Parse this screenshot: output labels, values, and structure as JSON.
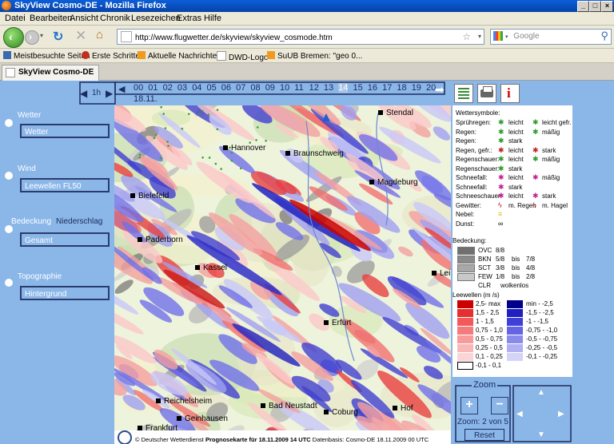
{
  "window": {
    "title": "SkyView Cosmo-DE - Mozilla Firefox"
  },
  "menu": [
    "Datei",
    "Bearbeiten",
    "Ansicht",
    "Chronik",
    "Lesezeichen",
    "Extras",
    "Hilfe"
  ],
  "nav": {
    "url": "http://www.flugwetter.de/skyview/skyview_cosmode.htm",
    "search_placeholder": "Google"
  },
  "bookmarks": [
    "Meistbesuchte Seiten",
    "Erste Schritte",
    "Aktuelle Nachrichten",
    "DWD-Logo",
    "SuUB Bremen: \"geo 0..."
  ],
  "tab": {
    "title": "SkyView Cosmo-DE"
  },
  "left": {
    "wetter_label": "Wetter",
    "wetter_value": "Wetter",
    "wind_label": "Wind",
    "wind_value": "Leewellen FL50",
    "bedeckung_label": "Bedeckung",
    "niederschlag_label": "Niederschlag",
    "bedeckung_value": "Gesamt",
    "topographie_label": "Topographie",
    "topographie_value": "Hintergrund"
  },
  "time": {
    "step": "1h",
    "hours": [
      "00",
      "01",
      "02",
      "03",
      "04",
      "05",
      "06",
      "07",
      "08",
      "09",
      "10",
      "11",
      "12",
      "13",
      "14",
      "15",
      "16",
      "17",
      "18",
      "19",
      "20"
    ],
    "selected": "14",
    "date": "18.11."
  },
  "cities": [
    {
      "name": "Stendal"
    },
    {
      "name": "Hannover"
    },
    {
      "name": "Braunschweig"
    },
    {
      "name": "Bielefeld"
    },
    {
      "name": "Magdeburg"
    },
    {
      "name": "Paderborn"
    },
    {
      "name": "Kassel"
    },
    {
      "name": "Leip"
    },
    {
      "name": "Erfurt"
    },
    {
      "name": "Reichelsheim"
    },
    {
      "name": "Bad Neustadt"
    },
    {
      "name": "Coburg"
    },
    {
      "name": "Hof"
    },
    {
      "name": "Frankfurt"
    },
    {
      "name": "Geinhausen"
    }
  ],
  "legend": {
    "wettersymbole_title": "Wettersymbole:",
    "weather_rows": [
      {
        "label": "Sprühregen:",
        "a": "leicht",
        "b": "leicht gefr."
      },
      {
        "label": "Regen:",
        "a": "leicht",
        "b": "mäßig"
      },
      {
        "label": "Regen:",
        "a": "stark",
        "b": ""
      },
      {
        "label": "Regen, gefr.:",
        "a": "leicht",
        "b": "stark"
      },
      {
        "label": "Regenschauer:",
        "a": "leicht",
        "b": "mäßig"
      },
      {
        "label": "Regenschauer:",
        "a": "stark",
        "b": ""
      },
      {
        "label": "Schneefall:",
        "a": "leicht",
        "b": "mäßig"
      },
      {
        "label": "Schneefall:",
        "a": "stark",
        "b": ""
      },
      {
        "label": "Schneeschauer:",
        "a": "leicht",
        "b": "stark"
      },
      {
        "label": "Gewitter:",
        "a": "m. Regen",
        "b": "m. Hagel"
      },
      {
        "label": "Nebel:",
        "a": "",
        "b": ""
      },
      {
        "label": "Dunst:",
        "a": "",
        "b": ""
      }
    ],
    "bedeckung_title": "Bedeckung:",
    "cover_rows": [
      {
        "code": "OVC",
        "f1": "8/8",
        "f2": ""
      },
      {
        "code": "BKN",
        "f1": "5/8",
        "bis": "bis",
        "f2": "7/8"
      },
      {
        "code": "SCT",
        "f1": "3/8",
        "bis": "bis",
        "f2": "4/8"
      },
      {
        "code": "FEW",
        "f1": "1/8",
        "bis": "bis",
        "f2": "2/8"
      },
      {
        "code": "CLR",
        "f1": "wolkenlos",
        "f2": ""
      }
    ],
    "leewellen_title": "Leewellen (m /s)",
    "lee_pos": [
      "2,5- max",
      "1,5 - 2,5",
      "1 - 1,5",
      "0,75 - 1,0",
      "0,5 - 0,75",
      "0,25 - 0,5",
      "0,1 - 0,25",
      "-0,1 - 0,1"
    ],
    "lee_neg": [
      "min - -2,5",
      "-1,5 - -2,5",
      "-1 - -1,5",
      "-0,75 - -1,0",
      "-0,5 - -0,75",
      "-0,25 - -0,5",
      "-0,1 - -0,25"
    ],
    "colors_pos": [
      "#cc0000",
      "#e63030",
      "#f05a5a",
      "#f47b7b",
      "#f69a9a",
      "#f8b8b8",
      "#fbd5d5",
      "#ffffff"
    ],
    "colors_neg": [
      "#00008a",
      "#2020c0",
      "#4040d8",
      "#6464e4",
      "#8a8aec",
      "#b0b0f2",
      "#d4d4f8"
    ]
  },
  "zoom": {
    "title": "Zoom",
    "plus": "+",
    "minus": "−",
    "status": "Zoom: 2 von 5",
    "reset": "Reset"
  },
  "footer": {
    "source": "© Deutscher Wetterdienst",
    "prog_label": "Prognosekarte für",
    "prog_time": "18.11.2009 14 UTC",
    "db_label": "Datenbasis: Cosmo-DE",
    "db_time": "18.11.2009 00 UTC"
  }
}
